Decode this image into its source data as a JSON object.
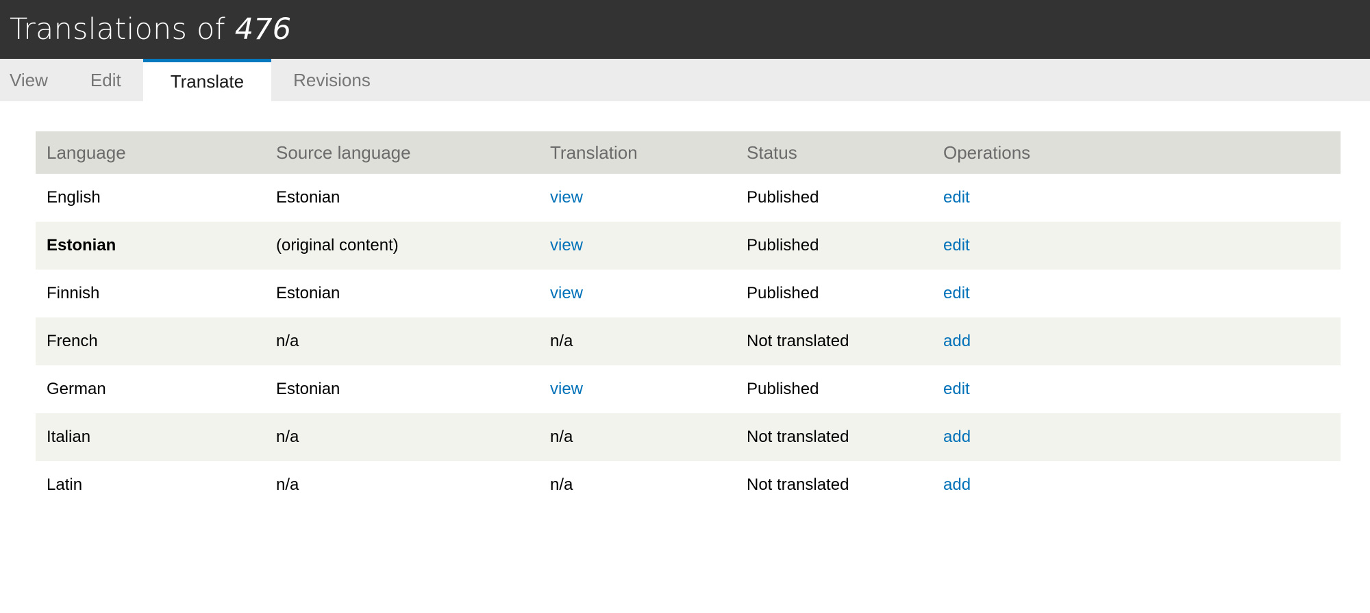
{
  "header": {
    "title_prefix": "Translations of ",
    "title_entity": "476"
  },
  "tabs": [
    {
      "label": "View",
      "active": false
    },
    {
      "label": "Edit",
      "active": false
    },
    {
      "label": "Translate",
      "active": true
    },
    {
      "label": "Revisions",
      "active": false
    }
  ],
  "table": {
    "columns": [
      "Language",
      "Source language",
      "Translation",
      "Status",
      "Operations"
    ],
    "rows": [
      {
        "language": "English",
        "original": false,
        "source": "Estonian",
        "translation": "view",
        "translation_is_link": true,
        "status": "Published",
        "operation": "edit",
        "operation_is_link": true
      },
      {
        "language": "Estonian",
        "original": true,
        "source": "(original content)",
        "translation": "view",
        "translation_is_link": true,
        "status": "Published",
        "operation": "edit",
        "operation_is_link": true
      },
      {
        "language": "Finnish",
        "original": false,
        "source": "Estonian",
        "translation": "view",
        "translation_is_link": true,
        "status": "Published",
        "operation": "edit",
        "operation_is_link": true
      },
      {
        "language": "French",
        "original": false,
        "source": "n/a",
        "translation": "n/a",
        "translation_is_link": false,
        "status": "Not translated",
        "operation": "add",
        "operation_is_link": true
      },
      {
        "language": "German",
        "original": false,
        "source": "Estonian",
        "translation": "view",
        "translation_is_link": true,
        "status": "Published",
        "operation": "edit",
        "operation_is_link": true
      },
      {
        "language": "Italian",
        "original": false,
        "source": "n/a",
        "translation": "n/a",
        "translation_is_link": false,
        "status": "Not translated",
        "operation": "add",
        "operation_is_link": true
      },
      {
        "language": "Latin",
        "original": false,
        "source": "n/a",
        "translation": "n/a",
        "translation_is_link": false,
        "status": "Not translated",
        "operation": "add",
        "operation_is_link": true
      }
    ]
  },
  "colors": {
    "header_bg": "#333333",
    "tabs_bg": "#ececec",
    "active_tab_accent": "#0678be",
    "table_head_bg": "#dfdfd9",
    "stripe_bg": "#f3f3ee",
    "link": "#0071b8"
  }
}
